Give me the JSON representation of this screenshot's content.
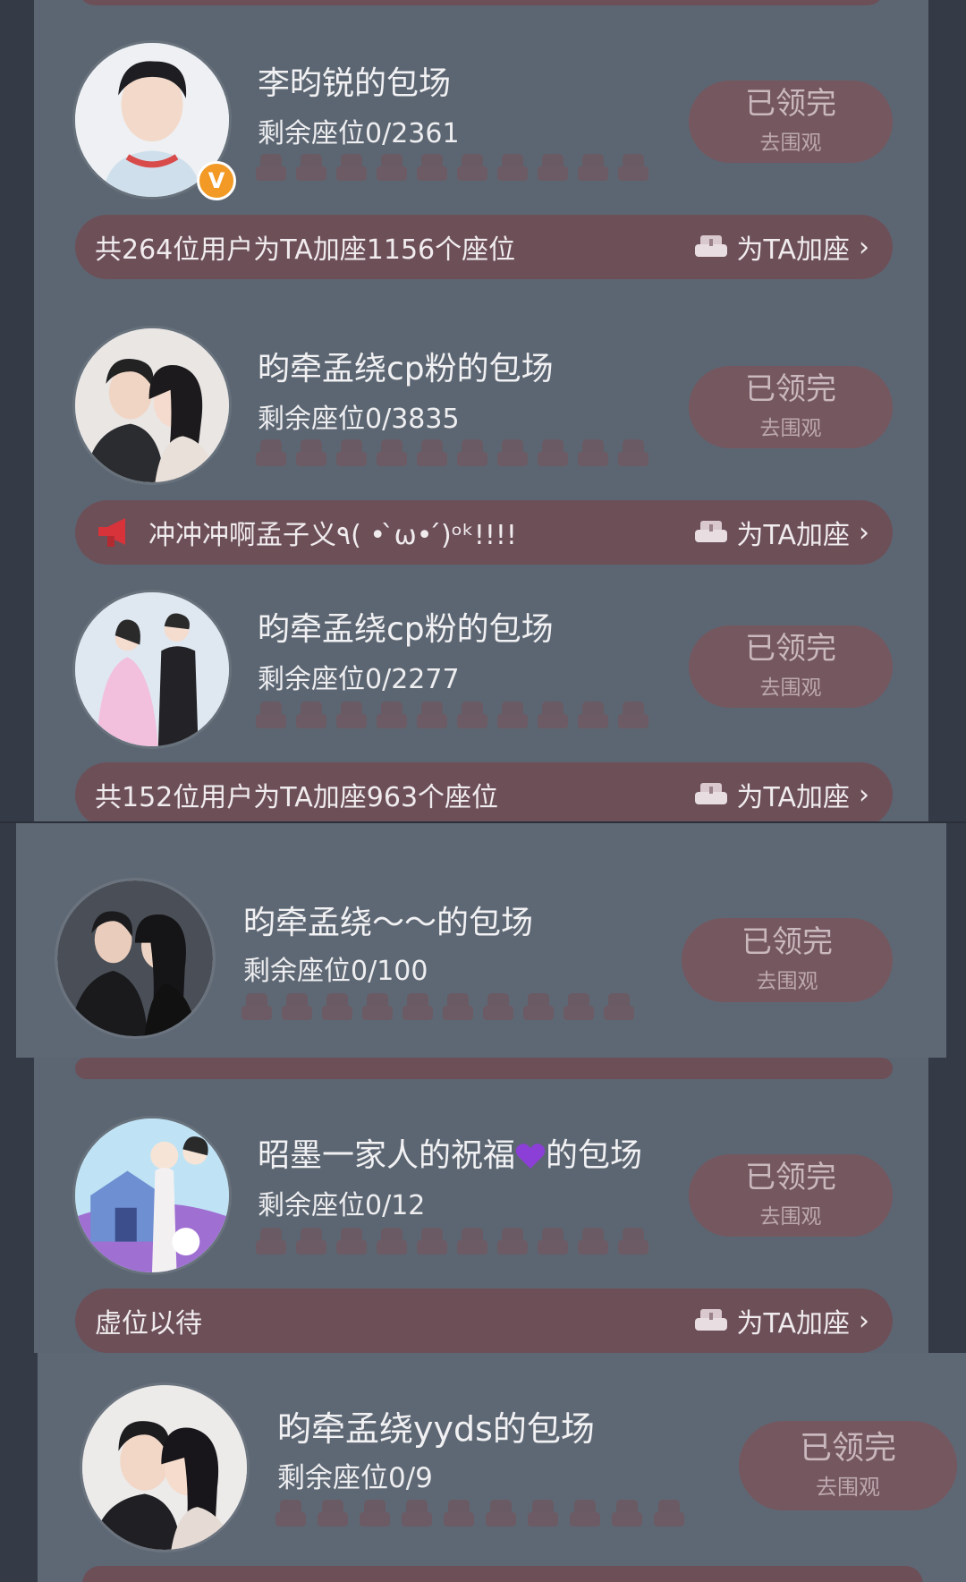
{
  "cards": [
    {
      "title": "李昀锐的包场",
      "seats": "剩余座位0/2361",
      "claim_main": "已领完",
      "claim_sub": "去围观",
      "bar_text": "共264位用户为TA加座1156个座位",
      "bar_action": "为TA加座",
      "badge": "V"
    },
    {
      "title": "昀牵孟绕cp粉的包场",
      "seats": "剩余座位0/3835",
      "claim_main": "已领完",
      "claim_sub": "去围观",
      "bar_text": "冲冲冲啊孟子义٩(  • ̀ω• ́)ᵒᵏ!!!!",
      "bar_action": "为TA加座"
    },
    {
      "title": "昀牵孟绕cp粉的包场",
      "seats": "剩余座位0/2277",
      "claim_main": "已领完",
      "claim_sub": "去围观",
      "bar_text": "共152位用户为TA加座963个座位",
      "bar_action": "为TA加座"
    },
    {
      "title": "昀牵孟绕～～的包场",
      "seats": "剩余座位0/100",
      "claim_main": "已领完",
      "claim_sub": "去围观"
    },
    {
      "title_prefix": "昭墨一家人的祝福",
      "title_suffix": "的包场",
      "seats": "剩余座位0/12",
      "claim_main": "已领完",
      "claim_sub": "去围观",
      "bar_text": "虚位以待",
      "bar_action": "为TA加座"
    },
    {
      "title": "昀牵孟绕yyds的包场",
      "seats": "剩余座位0/9",
      "claim_main": "已领完",
      "claim_sub": "去围观"
    }
  ],
  "colors": {
    "panel": "#5c6672",
    "bar": "#6d4f58",
    "button": "#75575f",
    "badge": "#f29a25",
    "megaphone": "#d8333a",
    "heart": "#8b3fd6"
  },
  "icons": [
    "sofa-icon",
    "chevron-right-icon",
    "megaphone-icon",
    "purple-heart-icon",
    "v-badge-icon",
    "seat-icon"
  ]
}
